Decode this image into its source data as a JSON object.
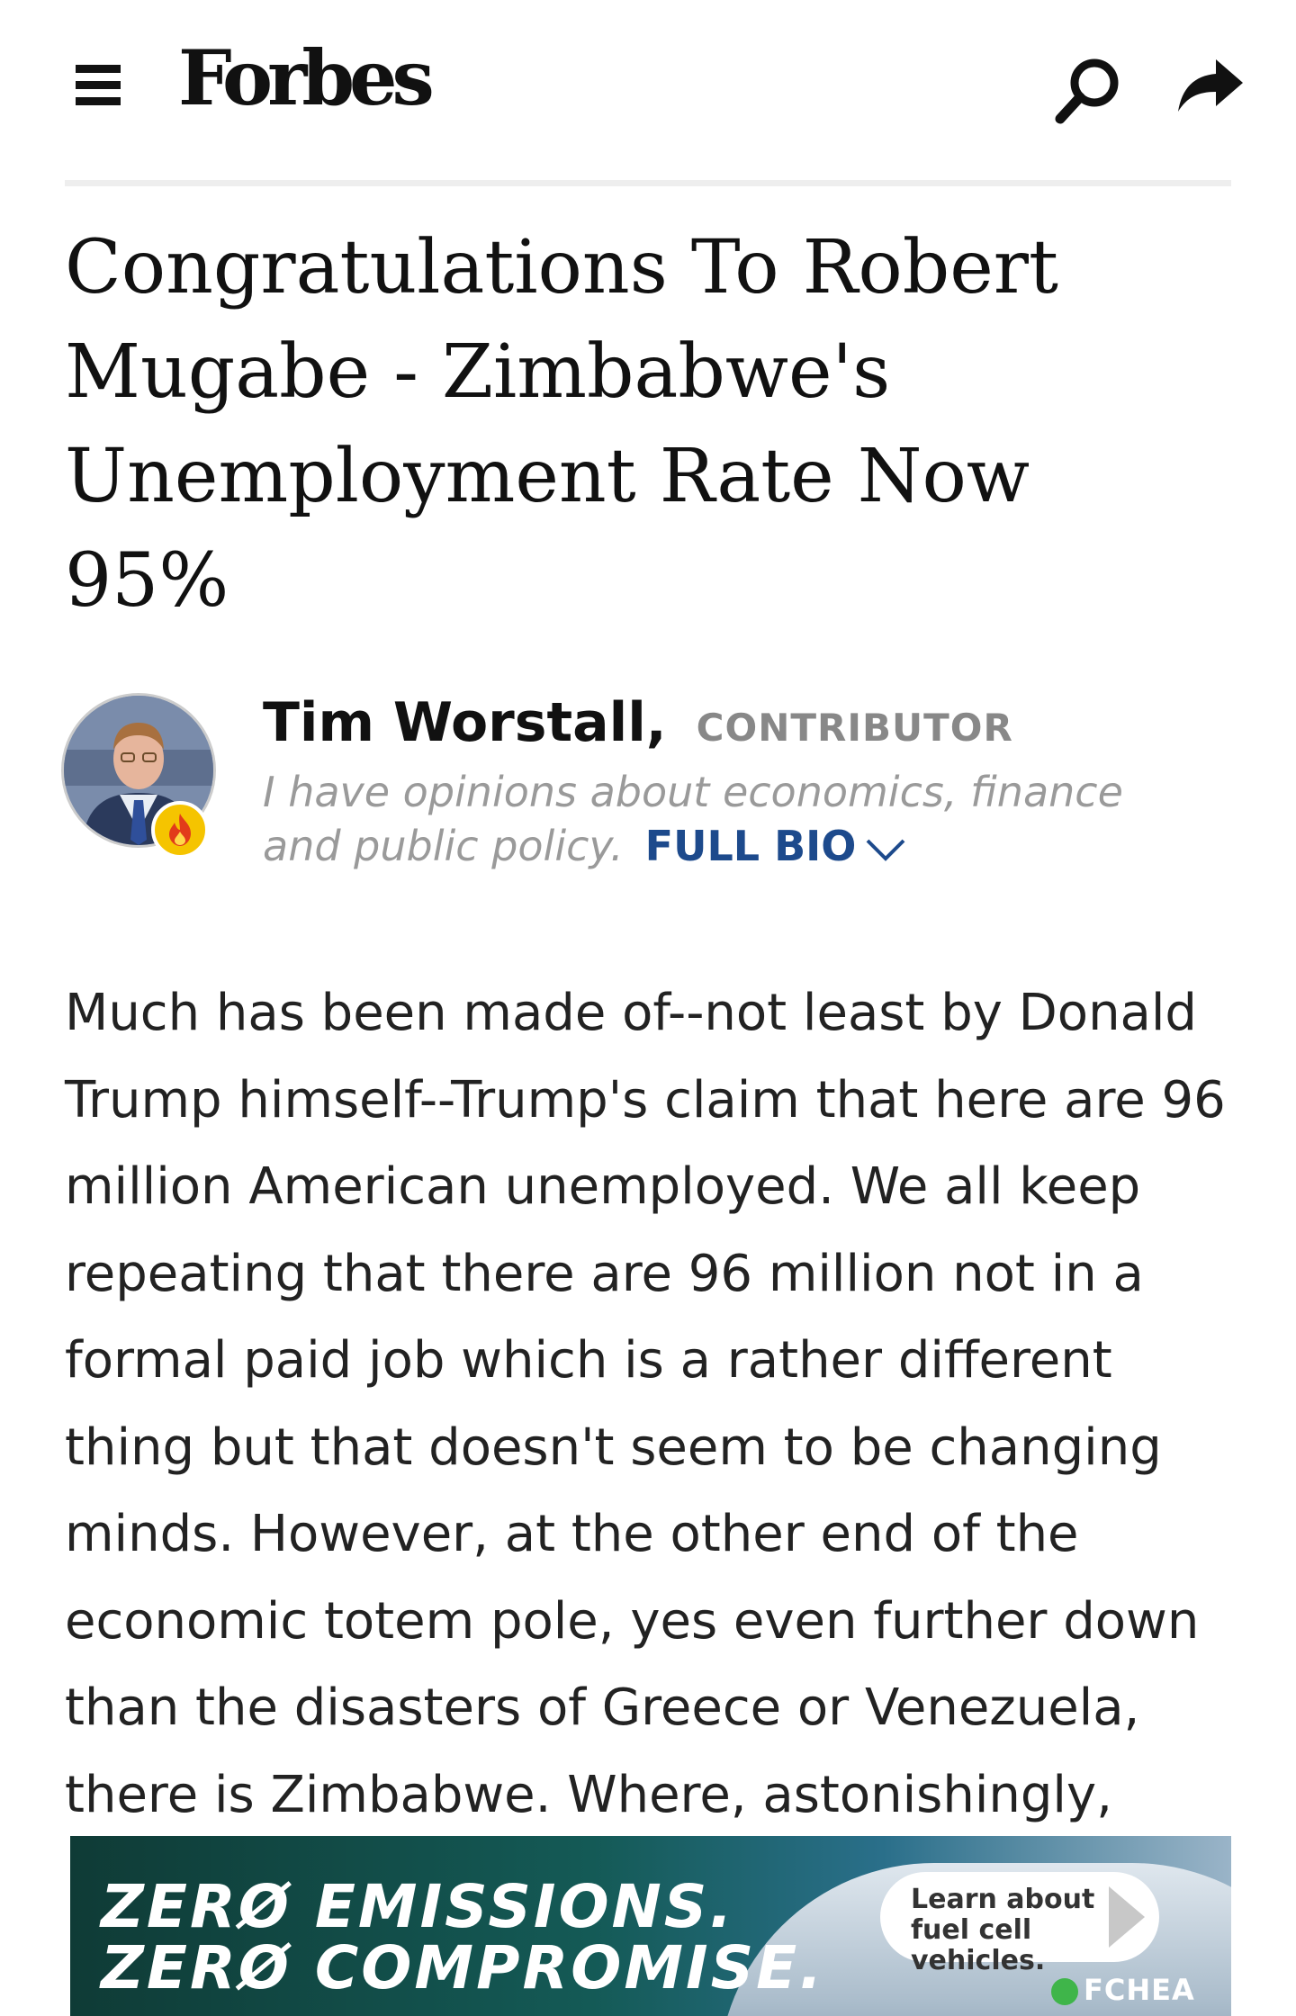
{
  "header": {
    "logo": "Forbes",
    "icons": {
      "menu": "hamburger-menu-icon",
      "search": "search-icon",
      "share": "share-icon"
    }
  },
  "article": {
    "title": "Congratulations To Robert Mugabe - Zimbabwe's Unemployment Rate Now 95%",
    "body": "Much has been made of--not least by Donald Trump himself--Trump's claim that here are 96 million American unemployed. We all keep repeating that there are 96 million not in a formal paid job which is a rather different thing but that doesn't seem to be changing minds. However, at the other end of the economic totem pole, yes even further down than the disasters of Greece or Venezuela, there is Zimbabwe. Where, astonishingly,"
  },
  "author": {
    "name": "Tim Worstall,",
    "role": "CONTRIBUTOR",
    "bio": "I have opinions about economics, finance and public policy.",
    "full_bio_label": "FULL BIO",
    "badge_icon": "flame-icon"
  },
  "ad": {
    "line1": "ZERØ EMISSIONS.",
    "line2": "ZERØ COMPROMISE.",
    "cta": "Learn about fuel cell vehicles.",
    "sponsor": "FCHEA"
  },
  "colors": {
    "link": "#1d4a8c",
    "muted": "#9a9a9a",
    "badge": "#f5c400",
    "divider": "#eeeeee"
  }
}
